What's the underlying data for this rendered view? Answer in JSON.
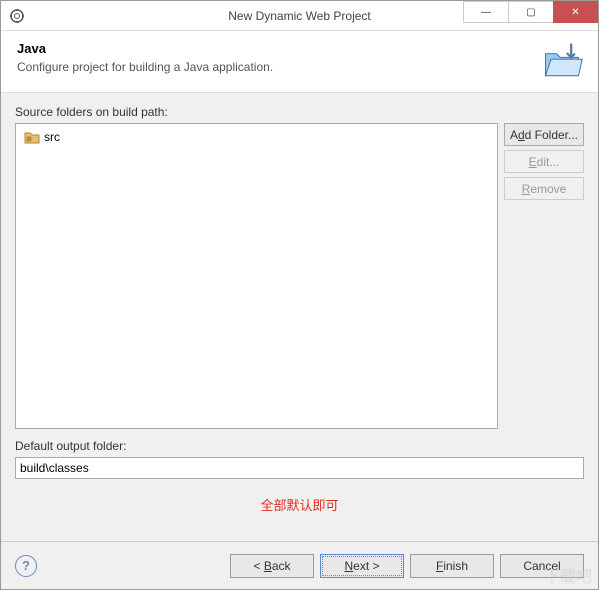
{
  "window": {
    "title": "New Dynamic Web Project",
    "minimize": "—",
    "maximize": "▢",
    "close": "✕"
  },
  "header": {
    "title": "Java",
    "description": "Configure project for building a Java application."
  },
  "source": {
    "label": "Source folders on build path:",
    "items": [
      {
        "name": "src"
      }
    ],
    "buttons": {
      "add_pre": "A",
      "add_ul": "d",
      "add_post": "d Folder...",
      "edit_ul": "E",
      "edit_post": "dit...",
      "remove_ul": "R",
      "remove_post": "emove"
    }
  },
  "output": {
    "label": "Default output folder:",
    "value": "build\\classes"
  },
  "annotation": "全部默认即可",
  "footer": {
    "back": {
      "pre": "< ",
      "ul": "B",
      "post": "ack"
    },
    "next": {
      "ul": "N",
      "post": "ext >"
    },
    "finish": {
      "ul": "F",
      "post": "inish"
    },
    "cancel": "Cancel",
    "help": "?"
  },
  "watermark": "下载吧"
}
